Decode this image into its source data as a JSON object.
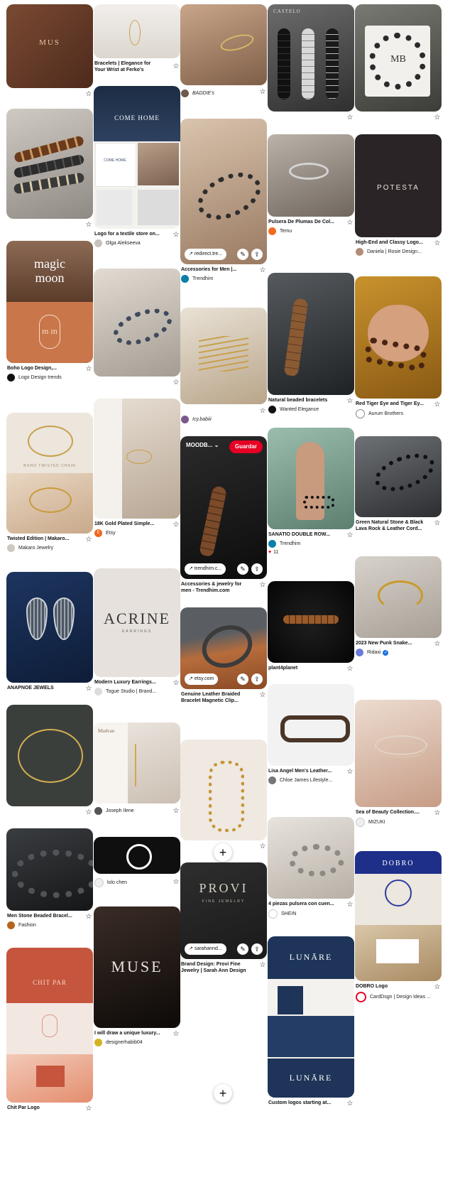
{
  "ui": {
    "pin_icon": "☆",
    "share_icon": "⇪",
    "edit_icon": "✎",
    "link_icon": "↗",
    "add_icon": "+"
  },
  "pins": {
    "p1": {
      "overlay": "MUS"
    },
    "p4": {
      "overlay_top": "magic",
      "overlay_mid": "moon",
      "overlay_logo": "m m",
      "title": "Boho Logo Design,...",
      "source": "Logo Design trends"
    },
    "p5": {
      "overlay": "BOHO TWISTED CHAIN",
      "title": "Twisted Edition | Makaro...",
      "source": "Makaro Jewelry"
    },
    "p6": {
      "title": "ANAPNOE JEWELS"
    },
    "p8": {
      "title": "Men Stone Beaded Bracel...",
      "source": "Fashion"
    },
    "p9": {
      "overlay_top": "CHIT PAR",
      "title": "Chit Par Logo"
    },
    "p10": {
      "title": "Bracelets | Elegance for\nYour Wrist at Ferko's"
    },
    "p11": {
      "overlay_top": "COME HOME",
      "overlay_mid": "COME HOME",
      "title": "Logo for a textile store on...",
      "source": "Olga Alekseeva"
    },
    "p13": {
      "title": "18K Gold Plated Simple...",
      "source": "Etsy"
    },
    "p14": {
      "overlay": "ACRINE",
      "overlay_sub": "EARRINGS",
      "title": "Modern Luxury Earrings...",
      "source": "Togue Studio | Brand..."
    },
    "p15": {
      "overlay": "Mudvan",
      "source": "Joseph Ilene"
    },
    "p16": {
      "source": "lolo chen"
    },
    "p17": {
      "overlay": "MUSE",
      "title": "I will draw a unique luxury...",
      "source": "designerhabib04"
    },
    "p18": {
      "source": "BADDIE's"
    },
    "p19": {
      "chip": "redirect.tre...",
      "title": "Accessories for Men |...",
      "source": "Trendhim"
    },
    "p20": {
      "source": "Icy.babiii"
    },
    "p21": {
      "board": "MOODB...",
      "save": "Guardar",
      "chip": "trendhim.c...",
      "title": "Accessories & jewelry for\nmen - Trendhim.com"
    },
    "p22": {
      "chip": "etsy.com",
      "title": "Genuine Leather Braided\nBracelet Magnetic Clip..."
    },
    "p24": {
      "overlay": "PROVI",
      "overlay_sub": "FINE JEWELRY",
      "chip": "sarahannd...",
      "title": "Brand Design: Provi Fine\nJewelry | Sarah Ann Design"
    },
    "p25": {
      "overlay": "CASTELO"
    },
    "p26": {
      "title": "Pulsera De Plumas De Col...",
      "source": "Temu"
    },
    "p27": {
      "title": "Natural beaded bracelets",
      "source": "Wanted Elegance"
    },
    "p28": {
      "title": "SANATIO DOUBLE ROW...",
      "source": "Trendhim",
      "likes": "11"
    },
    "p29": {
      "title": "plant4planet"
    },
    "p30": {
      "title": "Lisa Angel Men's Leather...",
      "source": "Chloe James Lifestyle..."
    },
    "p31": {
      "title": "4 piezas pulsera con cuen...",
      "source": "SHEIN"
    },
    "p32": {
      "overlay": "LUNĀRE",
      "title": "Custom logos starting at..."
    },
    "p33": {
      "overlay": "MB"
    },
    "p34": {
      "overlay": "POTESTA",
      "title": "High-End and Classy Logo...",
      "source": "Daniela | Rosie Design..."
    },
    "p35": {
      "title": "Red Tiger Eye and Tiger Ey...",
      "source": "Aurum Brothers"
    },
    "p36": {
      "title": "Green Natural Stone & Black\nLava Rock & Leather Cord..."
    },
    "p37": {
      "title": "2023 New Punk Snake...",
      "source": "Ridaxi"
    },
    "p38": {
      "title": "Sea of Beauty Collection....",
      "source": "MIZUKI"
    },
    "p39": {
      "overlay": "DOBRO",
      "title": "DOBRO Logo",
      "source": "CardDsgn | Design Ideas ..."
    }
  }
}
